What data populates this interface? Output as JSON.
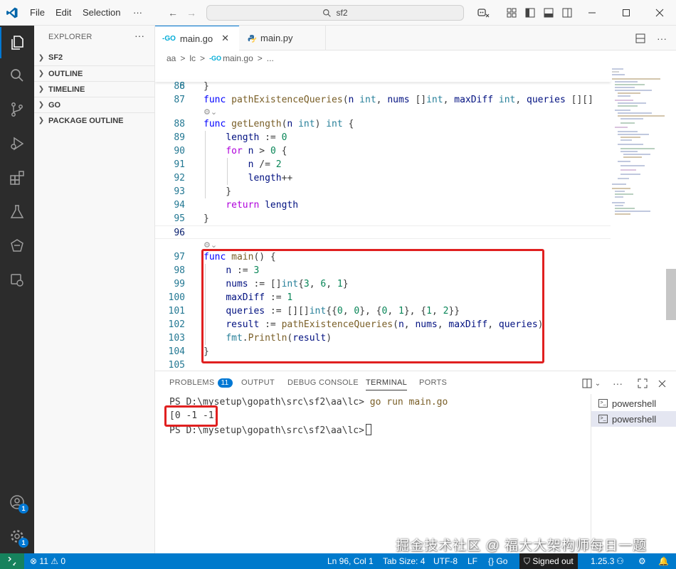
{
  "titlebar": {
    "menu": [
      "File",
      "Edit",
      "Selection"
    ],
    "more": "···",
    "search": "sf2",
    "colors": {
      "accent": "#0078d4",
      "logo": "#0065a9"
    }
  },
  "activity": {
    "icons": [
      "explorer-icon",
      "search-icon",
      "source-control-icon",
      "run-debug-icon",
      "extensions-icon",
      "testing-icon",
      "go-icon",
      "remote-icon"
    ],
    "account_badge": "1",
    "settings_badge": "1"
  },
  "sidebar": {
    "title": "EXPLORER",
    "more": "···",
    "sections": [
      "SF2",
      "OUTLINE",
      "TIMELINE",
      "GO",
      "PACKAGE OUTLINE"
    ]
  },
  "tabs": [
    {
      "label": "main.go",
      "icon": "-GO",
      "active": true
    },
    {
      "label": "main.py",
      "icon": "py",
      "active": false
    }
  ],
  "breadcrumb": [
    "aa",
    ">",
    "lc",
    ">",
    "main.go",
    ">",
    "..."
  ],
  "code": {
    "sticky": {
      "num": "8",
      "text": "func pathExistenceQueries(n int, nums []int, maxDiff int, queries [][]"
    },
    "lines": [
      {
        "num": "86",
        "text": "}"
      },
      {
        "num": "87",
        "text": ""
      },
      {
        "num": "88",
        "text": "func getLength(n int) int {"
      },
      {
        "num": "89",
        "text": "    length := 0"
      },
      {
        "num": "90",
        "text": "    for n > 0 {"
      },
      {
        "num": "91",
        "text": "        n /= 2"
      },
      {
        "num": "92",
        "text": "        length++"
      },
      {
        "num": "93",
        "text": "    }"
      },
      {
        "num": "94",
        "text": "    return length"
      },
      {
        "num": "95",
        "text": "}"
      },
      {
        "num": "96",
        "text": ""
      },
      {
        "num": "97",
        "text": "func main() {"
      },
      {
        "num": "98",
        "text": "    n := 3"
      },
      {
        "num": "99",
        "text": "    nums := []int{3, 6, 1}"
      },
      {
        "num": "100",
        "text": "    maxDiff := 1"
      },
      {
        "num": "101",
        "text": "    queries := [][]int{{0, 0}, {0, 1}, {1, 2}}"
      },
      {
        "num": "102",
        "text": "    result := pathExistenceQueries(n, nums, maxDiff, queries)"
      },
      {
        "num": "103",
        "text": "    fmt.Println(result)"
      },
      {
        "num": "104",
        "text": "}"
      },
      {
        "num": "105",
        "text": ""
      }
    ]
  },
  "panel": {
    "tabs": [
      {
        "label": "PROBLEMS",
        "badge": "11"
      },
      {
        "label": "OUTPUT"
      },
      {
        "label": "DEBUG CONSOLE"
      },
      {
        "label": "TERMINAL",
        "active": true
      },
      {
        "label": "PORTS"
      }
    ],
    "terminal": {
      "line1_prompt": "PS D:\\mysetup\\gopath\\src\\sf2\\aa\\lc>",
      "line1_cmd": "go run main.go",
      "output": "[0 -1 -1]",
      "line3_prompt": "PS D:\\mysetup\\gopath\\src\\sf2\\aa\\lc>"
    },
    "terminals": [
      "powershell",
      "powershell"
    ]
  },
  "statusbar": {
    "errors": "11",
    "warnings": "0",
    "position": "Ln 96, Col 1",
    "tabsize": "Tab Size: 4",
    "encoding": "UTF-8",
    "eol": "LF",
    "language": "Go",
    "account": "Signed out",
    "version": "1.25.3",
    "colors": {
      "bg": "#007acc",
      "remote": "#16825d"
    }
  },
  "watermark": "掘金技术社区 @ 福大大架构师每日一题"
}
